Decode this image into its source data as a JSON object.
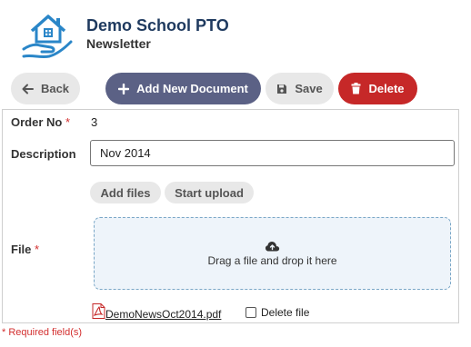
{
  "header": {
    "title": "Demo School PTO",
    "subtitle": "Newsletter",
    "logo_icon": "house-in-hand-icon"
  },
  "toolbar": {
    "back_label": "Back",
    "add_label": "Add New Document",
    "save_label": "Save",
    "delete_label": "Delete"
  },
  "form": {
    "order_no_label": "Order No",
    "order_no_value": "3",
    "description_label": "Description",
    "description_value": "Nov 2014",
    "add_files_label": "Add files",
    "start_upload_label": "Start upload",
    "file_label": "File",
    "dropzone_text": "Drag a file and drop it here",
    "file_name": "DemoNewsOct2014.pdf",
    "delete_file_label": "Delete file",
    "required_marker": "*"
  },
  "footer": {
    "required_note": "* Required field(s)"
  },
  "colors": {
    "add_button": "#5b6185",
    "delete_button": "#c62828",
    "title": "#1f3a5f",
    "required": "#d32f2f"
  }
}
